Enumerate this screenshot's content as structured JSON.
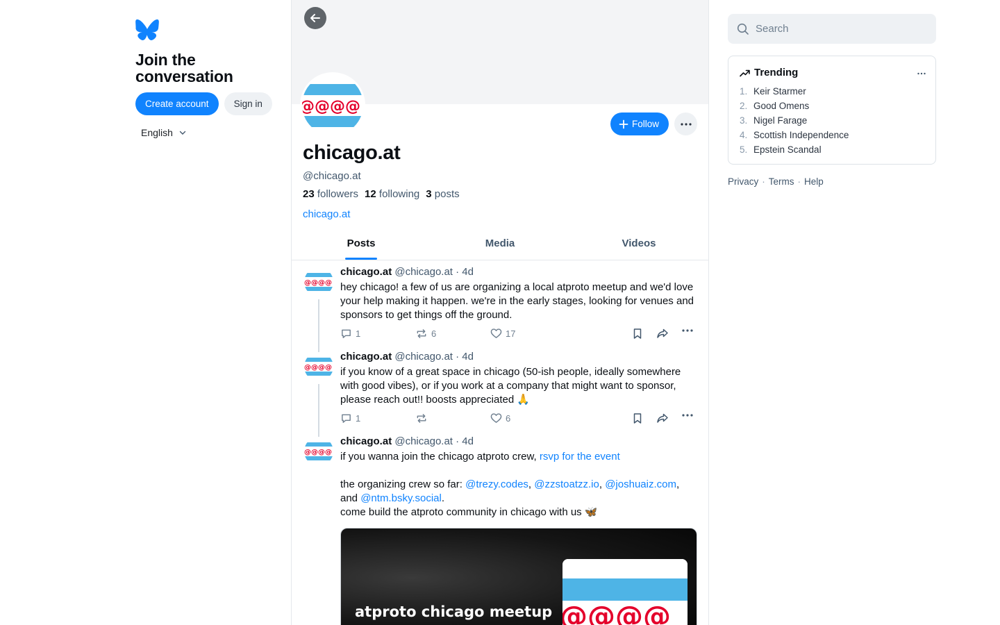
{
  "left": {
    "join_title": "Join the conversation",
    "create_account": "Create account",
    "sign_in": "Sign in",
    "language": "English"
  },
  "profile": {
    "display_name": "chicago.at",
    "handle": "@chicago.at",
    "followers_count": "23",
    "followers_label": "followers",
    "following_count": "12",
    "following_label": "following",
    "posts_count": "3",
    "posts_label": "posts",
    "link": "chicago.at",
    "follow_label": "Follow"
  },
  "tabs": [
    {
      "label": "Posts",
      "active": true
    },
    {
      "label": "Media",
      "active": false
    },
    {
      "label": "Videos",
      "active": false
    }
  ],
  "posts": [
    {
      "name": "chicago.at",
      "handle": "@chicago.at",
      "time": "· 4d",
      "text": "hey chicago! a few of us are organizing a local atproto meetup and we'd love your help making it happen. we're in the early stages, looking for venues and sponsors to get things off the ground.",
      "replies": "1",
      "reposts": "6",
      "likes": "17"
    },
    {
      "name": "chicago.at",
      "handle": "@chicago.at",
      "time": "· 4d",
      "text": "if you know of a great space in chicago (50-ish people, ideally somewhere with good vibes), or if you work at a company that might want to sponsor, please reach out!! boosts appreciated 🙏",
      "replies": "1",
      "reposts": "",
      "likes": "6"
    },
    {
      "name": "chicago.at",
      "handle": "@chicago.at",
      "time": "· 4d",
      "text_1": "if you wanna join the chicago atproto crew, ",
      "link_rsvp": "rsvp for the event",
      "text_2": "the organizing crew so far: ",
      "mention_1": "@trezy.codes",
      "sep_1": ", ",
      "mention_2": "@zzstoatzz.io",
      "sep_2": ", ",
      "mention_3": "@joshuaiz.com",
      "sep_3": ", and ",
      "mention_4": "@ntm.bsky.social",
      "sep_4": ".",
      "text_3": "come build the atproto community in chicago with us 🦋",
      "embed_title": "atproto chicago meetup"
    }
  ],
  "search": {
    "placeholder": "Search"
  },
  "trending": {
    "title": "Trending",
    "items": [
      {
        "num": "1.",
        "label": "Keir Starmer"
      },
      {
        "num": "2.",
        "label": "Good Omens"
      },
      {
        "num": "3.",
        "label": "Nigel Farage"
      },
      {
        "num": "4.",
        "label": "Scottish Independence"
      },
      {
        "num": "5.",
        "label": "Epstein Scandal"
      }
    ]
  },
  "footer": {
    "privacy": "Privacy",
    "terms": "Terms",
    "help": "Help",
    "separator": "·"
  },
  "colors": {
    "accent": "#1083fe",
    "flag_blue": "#4eb4e6",
    "flag_red": "#e4002b"
  }
}
